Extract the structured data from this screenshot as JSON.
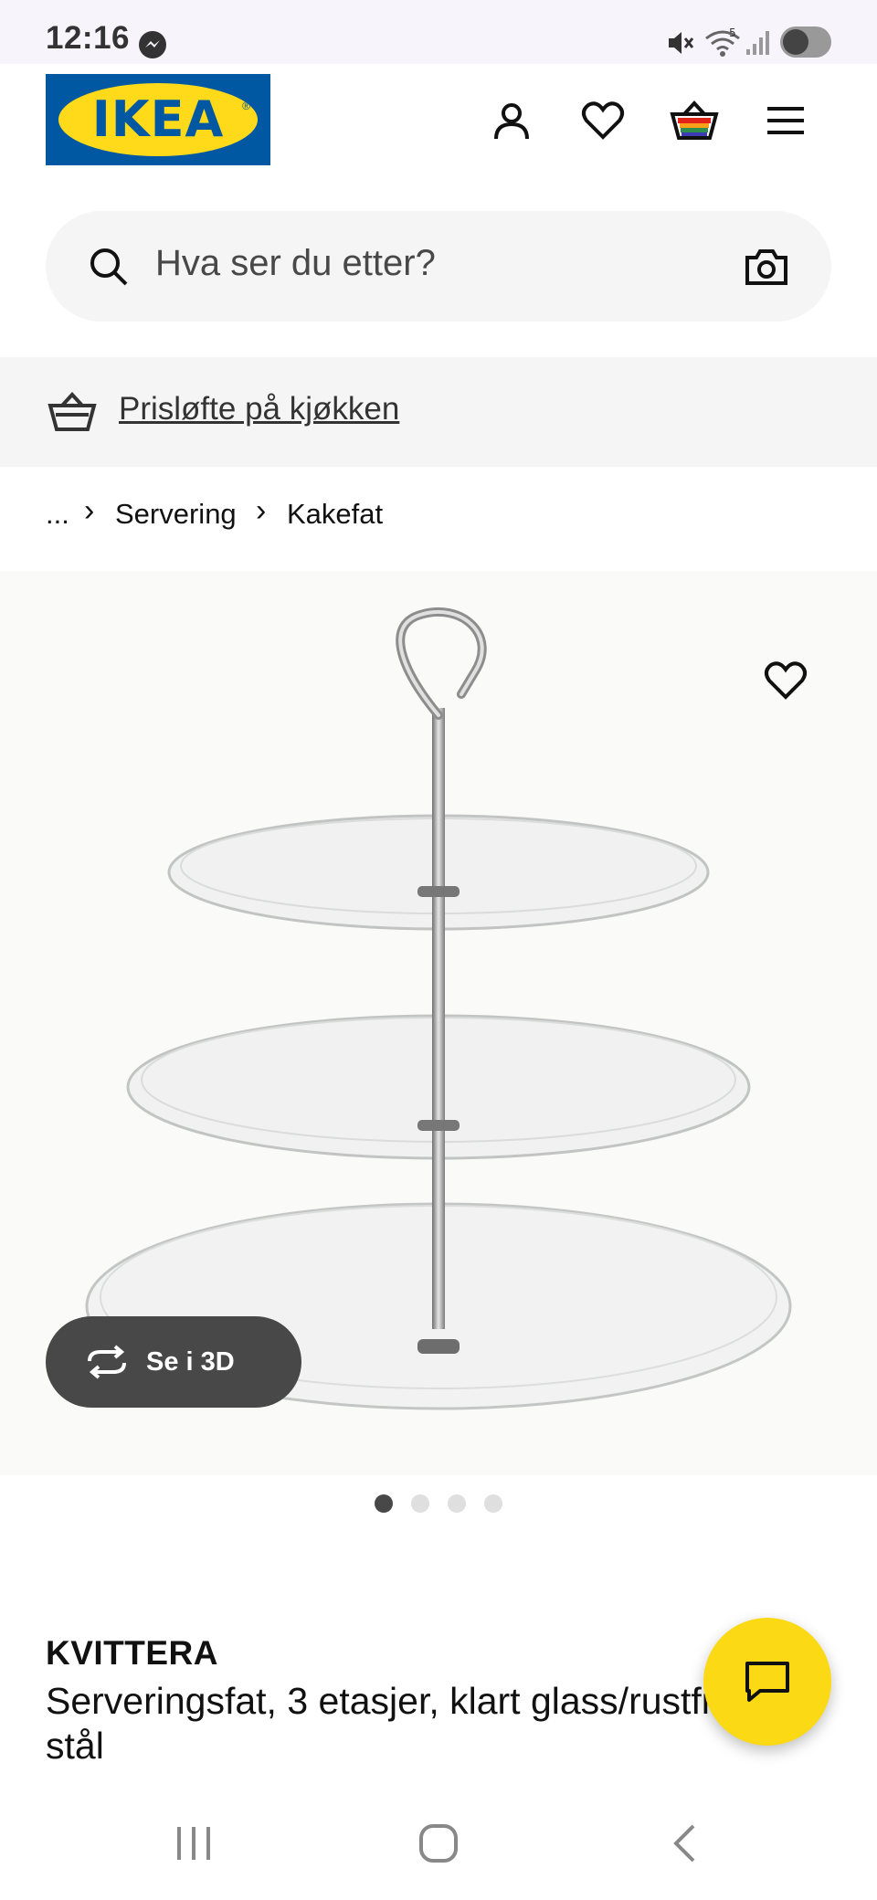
{
  "status_bar": {
    "time": "12:16",
    "icons": [
      "messenger-icon",
      "mute-icon",
      "wifi-icon",
      "signal-icon",
      "battery-icon"
    ],
    "wifi_badge": "5"
  },
  "header": {
    "logo_text": "IKEA",
    "icons": [
      "account-icon",
      "heart-icon",
      "basket-icon",
      "menu-icon"
    ]
  },
  "search": {
    "placeholder": "Hva ser du etter?"
  },
  "promo": {
    "label": "Prisløfte på kjøkken"
  },
  "breadcrumb": {
    "items": [
      "...",
      "Servering",
      "Kakefat"
    ]
  },
  "product": {
    "view_3d_label": "Se i 3D",
    "image_count": 4,
    "active_image": 1,
    "name": "KVITTERA",
    "description": "Serveringsfat, 3 etasjer, klart glass/rustfritt stål"
  },
  "colors": {
    "ikea_blue": "#0058a3",
    "ikea_yellow": "#ffda1a",
    "chat_yellow": "#fbd914"
  }
}
